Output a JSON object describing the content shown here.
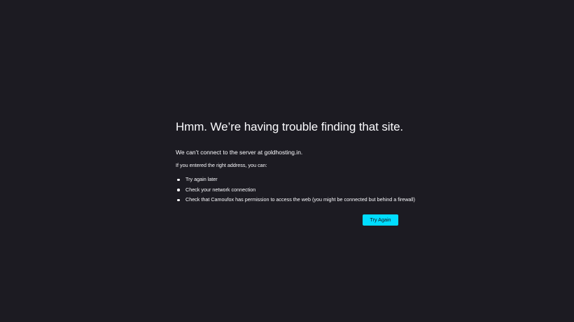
{
  "error": {
    "title": "Hmm. We’re having trouble finding that site.",
    "description": "We can’t connect to the server at goldhosting.in.",
    "hint": "If you entered the right address, you can:",
    "suggestions": [
      "Try again later",
      "Check your network connection",
      "Check that Camoufox has permission to access the web (you might be connected but behind a firewall)"
    ],
    "try_again_label": "Try Again"
  },
  "colors": {
    "background": "#1c1b22",
    "text": "#fbfbfe",
    "accent": "#00ddff"
  }
}
